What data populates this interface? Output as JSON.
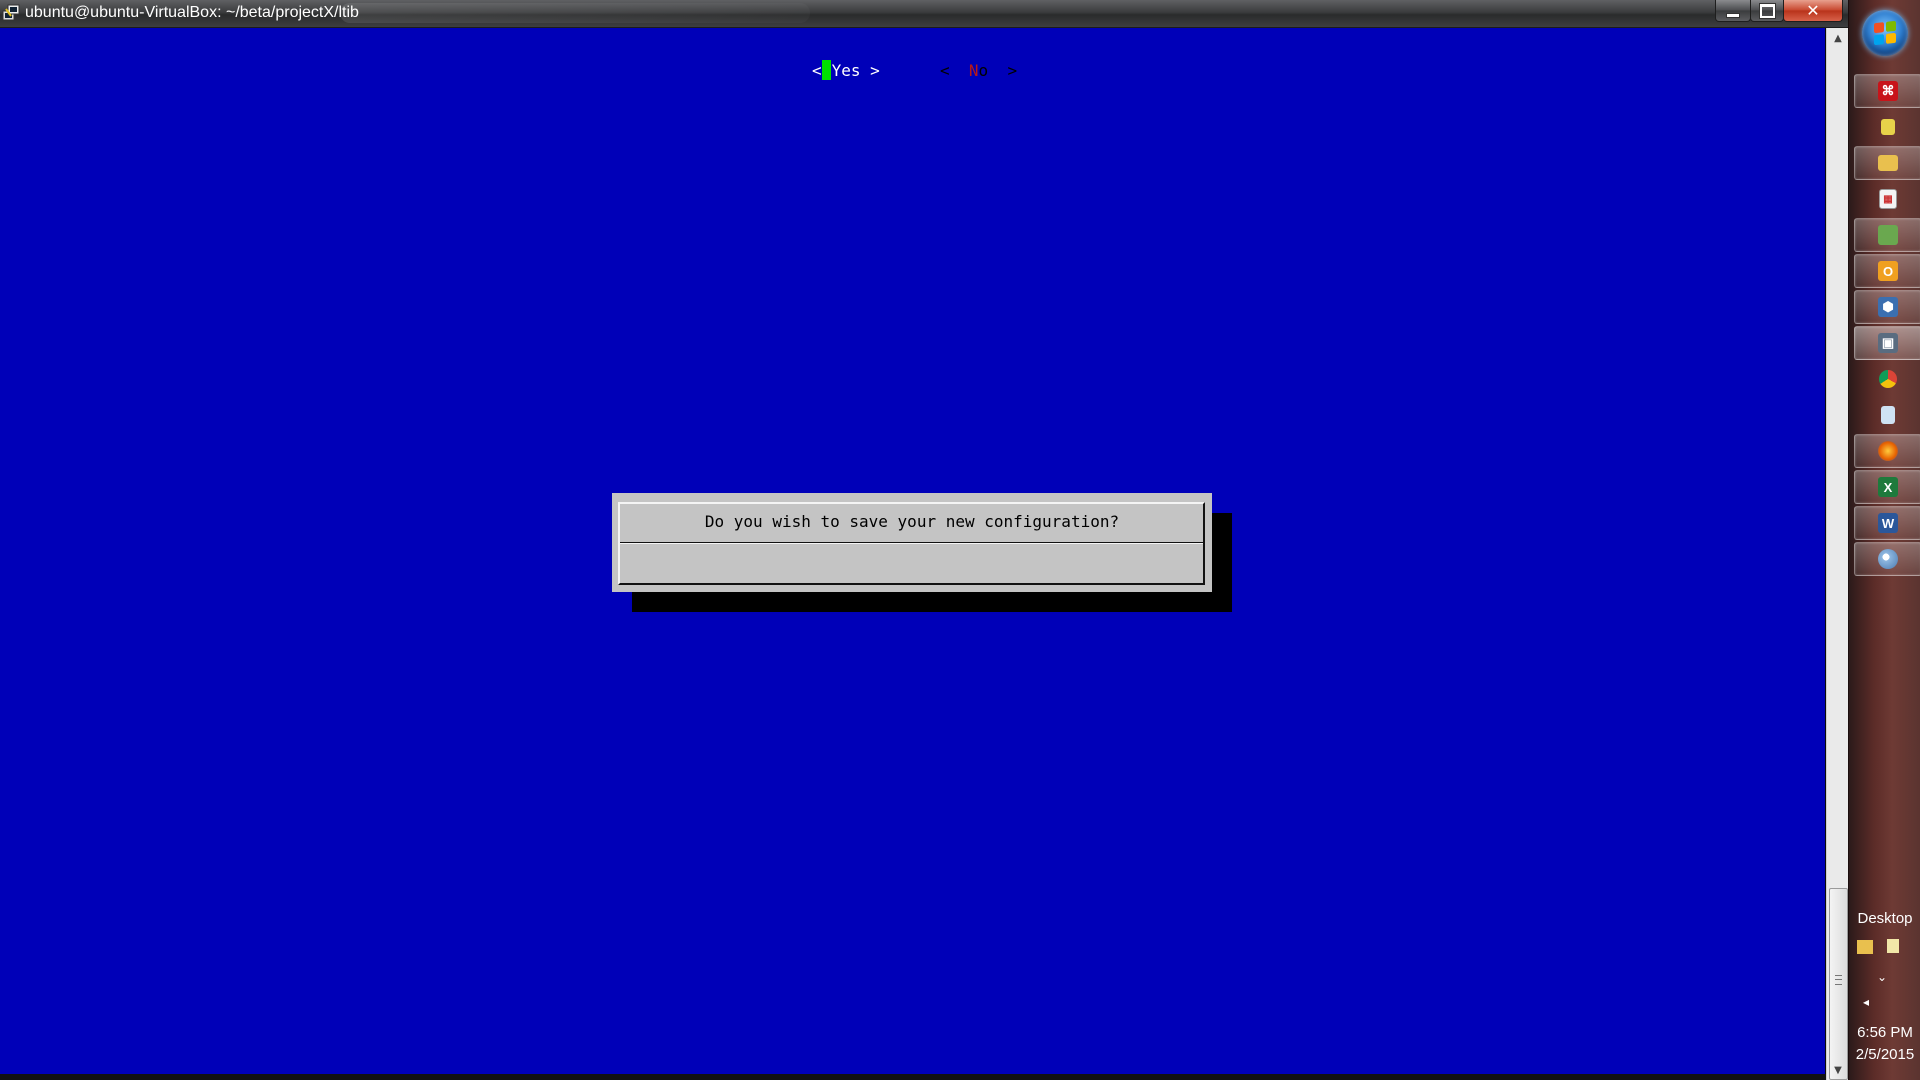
{
  "window": {
    "title": "ubuntu@ubuntu-VirtualBox: ~/beta/projectX/ltib",
    "close_glyph": "✕"
  },
  "dialog": {
    "question": "Do you wish to save your new configuration?",
    "yes_open": "<",
    "yes_label": "Yes",
    "yes_close": " >",
    "no_open": "<  ",
    "no_hotkey": "N",
    "no_rest": "o  >",
    "selected": "Yes"
  },
  "taskbar": {
    "pinned_icons": [
      "adobe-reader-icon",
      "sticky-notes-icon",
      "windows-explorer-icon",
      "calculator-icon",
      "image-viewer-icon",
      "outlook-icon",
      "virtualbox-icon",
      "putty-icon",
      "chrome-icon",
      "notepad-icon",
      "firefox-icon",
      "excel-icon",
      "word-icon",
      "paint-icon"
    ],
    "desktop_label": "Desktop",
    "clock": {
      "time": "6:56 PM",
      "date": "2/5/2015"
    }
  },
  "colors": {
    "terminal_bg": "#0000b8",
    "dialog_bg": "#c4c4c4",
    "selected_button_bg": "#0000b8",
    "cursor": "#00e000",
    "hotkey": "#b81818"
  }
}
